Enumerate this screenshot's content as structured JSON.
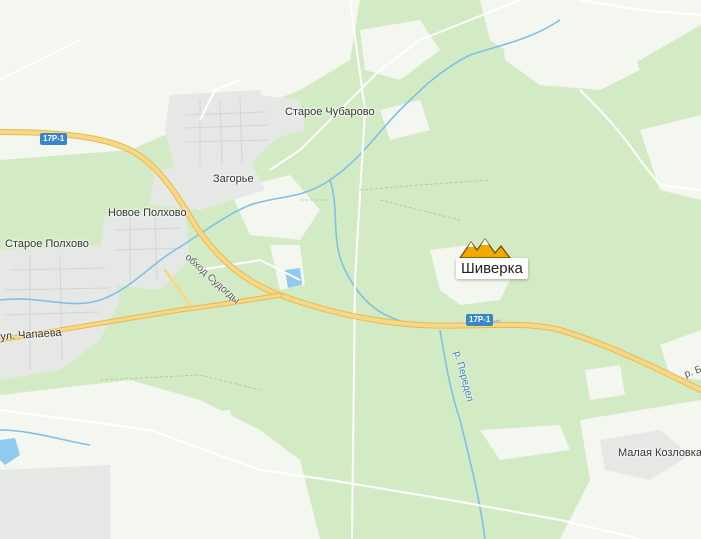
{
  "colors": {
    "forest": "#d3ebc4",
    "open_land": "#f3f7ef",
    "settlement": "#e6e8e6",
    "water": "#5bb0e6",
    "major_road": "#f5d07a",
    "poi": "#f2a900"
  },
  "places": {
    "staroe_chubarovo": "Старое Чубарово",
    "zagorye": "Загорье",
    "novoe_polkhovo": "Новое Полхово",
    "staroe_polkhovo": "Старое Полхово",
    "ul_chapaeva": "ул. Чапаева",
    "malaya_kozlovka": "Малая Козловка"
  },
  "roads": {
    "shield_1": "17Р-1",
    "shield_2": "17Р-1",
    "bypass": "обход Судогды",
    "river_edge": "р. Б"
  },
  "rivers": {
    "peredel": "р. Передел"
  },
  "poi": {
    "name": "Шиверка",
    "icon": "mountain-icon"
  }
}
